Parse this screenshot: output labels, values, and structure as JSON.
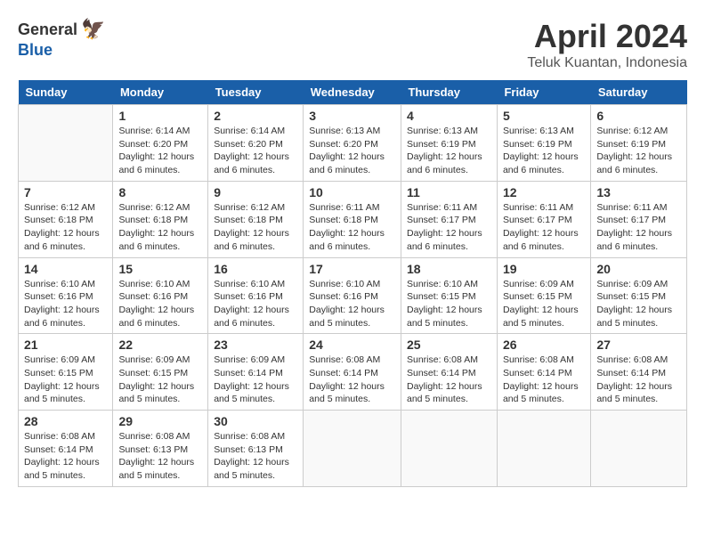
{
  "logo": {
    "general": "General",
    "blue": "Blue"
  },
  "title": "April 2024",
  "subtitle": "Teluk Kuantan, Indonesia",
  "days_of_week": [
    "Sunday",
    "Monday",
    "Tuesday",
    "Wednesday",
    "Thursday",
    "Friday",
    "Saturday"
  ],
  "weeks": [
    [
      {
        "day": "",
        "info": ""
      },
      {
        "day": "1",
        "info": "Sunrise: 6:14 AM\nSunset: 6:20 PM\nDaylight: 12 hours\nand 6 minutes."
      },
      {
        "day": "2",
        "info": "Sunrise: 6:14 AM\nSunset: 6:20 PM\nDaylight: 12 hours\nand 6 minutes."
      },
      {
        "day": "3",
        "info": "Sunrise: 6:13 AM\nSunset: 6:20 PM\nDaylight: 12 hours\nand 6 minutes."
      },
      {
        "day": "4",
        "info": "Sunrise: 6:13 AM\nSunset: 6:19 PM\nDaylight: 12 hours\nand 6 minutes."
      },
      {
        "day": "5",
        "info": "Sunrise: 6:13 AM\nSunset: 6:19 PM\nDaylight: 12 hours\nand 6 minutes."
      },
      {
        "day": "6",
        "info": "Sunrise: 6:12 AM\nSunset: 6:19 PM\nDaylight: 12 hours\nand 6 minutes."
      }
    ],
    [
      {
        "day": "7",
        "info": "Sunrise: 6:12 AM\nSunset: 6:18 PM\nDaylight: 12 hours\nand 6 minutes."
      },
      {
        "day": "8",
        "info": "Sunrise: 6:12 AM\nSunset: 6:18 PM\nDaylight: 12 hours\nand 6 minutes."
      },
      {
        "day": "9",
        "info": "Sunrise: 6:12 AM\nSunset: 6:18 PM\nDaylight: 12 hours\nand 6 minutes."
      },
      {
        "day": "10",
        "info": "Sunrise: 6:11 AM\nSunset: 6:18 PM\nDaylight: 12 hours\nand 6 minutes."
      },
      {
        "day": "11",
        "info": "Sunrise: 6:11 AM\nSunset: 6:17 PM\nDaylight: 12 hours\nand 6 minutes."
      },
      {
        "day": "12",
        "info": "Sunrise: 6:11 AM\nSunset: 6:17 PM\nDaylight: 12 hours\nand 6 minutes."
      },
      {
        "day": "13",
        "info": "Sunrise: 6:11 AM\nSunset: 6:17 PM\nDaylight: 12 hours\nand 6 minutes."
      }
    ],
    [
      {
        "day": "14",
        "info": "Sunrise: 6:10 AM\nSunset: 6:16 PM\nDaylight: 12 hours\nand 6 minutes."
      },
      {
        "day": "15",
        "info": "Sunrise: 6:10 AM\nSunset: 6:16 PM\nDaylight: 12 hours\nand 6 minutes."
      },
      {
        "day": "16",
        "info": "Sunrise: 6:10 AM\nSunset: 6:16 PM\nDaylight: 12 hours\nand 6 minutes."
      },
      {
        "day": "17",
        "info": "Sunrise: 6:10 AM\nSunset: 6:16 PM\nDaylight: 12 hours\nand 5 minutes."
      },
      {
        "day": "18",
        "info": "Sunrise: 6:10 AM\nSunset: 6:15 PM\nDaylight: 12 hours\nand 5 minutes."
      },
      {
        "day": "19",
        "info": "Sunrise: 6:09 AM\nSunset: 6:15 PM\nDaylight: 12 hours\nand 5 minutes."
      },
      {
        "day": "20",
        "info": "Sunrise: 6:09 AM\nSunset: 6:15 PM\nDaylight: 12 hours\nand 5 minutes."
      }
    ],
    [
      {
        "day": "21",
        "info": "Sunrise: 6:09 AM\nSunset: 6:15 PM\nDaylight: 12 hours\nand 5 minutes."
      },
      {
        "day": "22",
        "info": "Sunrise: 6:09 AM\nSunset: 6:15 PM\nDaylight: 12 hours\nand 5 minutes."
      },
      {
        "day": "23",
        "info": "Sunrise: 6:09 AM\nSunset: 6:14 PM\nDaylight: 12 hours\nand 5 minutes."
      },
      {
        "day": "24",
        "info": "Sunrise: 6:08 AM\nSunset: 6:14 PM\nDaylight: 12 hours\nand 5 minutes."
      },
      {
        "day": "25",
        "info": "Sunrise: 6:08 AM\nSunset: 6:14 PM\nDaylight: 12 hours\nand 5 minutes."
      },
      {
        "day": "26",
        "info": "Sunrise: 6:08 AM\nSunset: 6:14 PM\nDaylight: 12 hours\nand 5 minutes."
      },
      {
        "day": "27",
        "info": "Sunrise: 6:08 AM\nSunset: 6:14 PM\nDaylight: 12 hours\nand 5 minutes."
      }
    ],
    [
      {
        "day": "28",
        "info": "Sunrise: 6:08 AM\nSunset: 6:14 PM\nDaylight: 12 hours\nand 5 minutes."
      },
      {
        "day": "29",
        "info": "Sunrise: 6:08 AM\nSunset: 6:13 PM\nDaylight: 12 hours\nand 5 minutes."
      },
      {
        "day": "30",
        "info": "Sunrise: 6:08 AM\nSunset: 6:13 PM\nDaylight: 12 hours\nand 5 minutes."
      },
      {
        "day": "",
        "info": ""
      },
      {
        "day": "",
        "info": ""
      },
      {
        "day": "",
        "info": ""
      },
      {
        "day": "",
        "info": ""
      }
    ]
  ]
}
